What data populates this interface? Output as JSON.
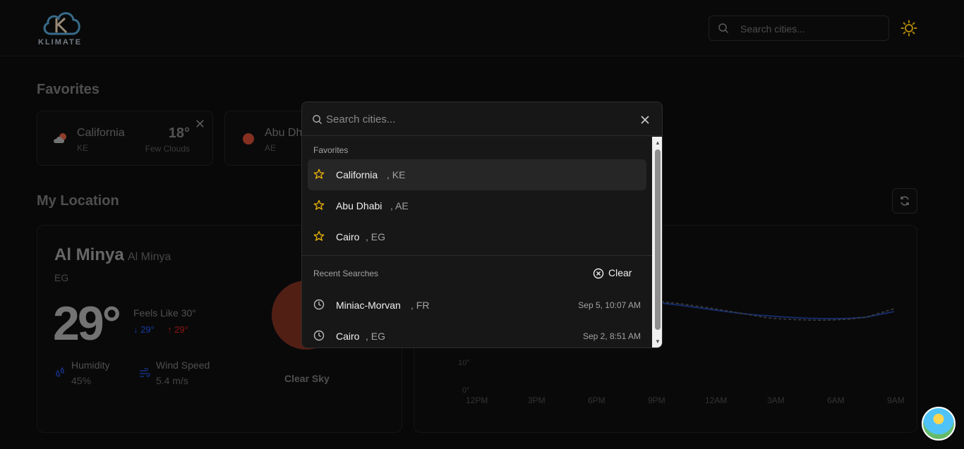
{
  "app": {
    "logo_text": "KLIMATE",
    "search_placeholder": "Search cities..."
  },
  "favorites_section": {
    "title": "Favorites",
    "cards": [
      {
        "city": "California",
        "country": "KE",
        "temp": "18°",
        "condition": "Few Clouds"
      },
      {
        "city": "Abu Dh",
        "country": "AE"
      }
    ]
  },
  "my_location": {
    "title": "My Location",
    "city": "Al Minya",
    "region": ", Al Minya",
    "country": "EG",
    "temp": "29°",
    "feels_like": "Feels Like 30°",
    "temp_min": "29°",
    "temp_max": "29°",
    "humidity_label": "Humidity",
    "humidity_value": "45%",
    "wind_label": "Wind Speed",
    "wind_value": "5.4 m/s",
    "condition": "Clear Sky"
  },
  "chart_data": {
    "type": "line",
    "x": [
      "12PM",
      "3PM",
      "6PM",
      "9PM",
      "12AM",
      "3AM",
      "6AM",
      "9AM"
    ],
    "y_ticks": [
      "10°",
      "0°"
    ]
  },
  "dialog": {
    "placeholder": "Search cities...",
    "favorites_heading": "Favorites",
    "favorites": [
      {
        "name": "California",
        "country": ", KE"
      },
      {
        "name": "Abu Dhabi",
        "country": ", AE"
      },
      {
        "name": "Cairo",
        "country": ", EG"
      }
    ],
    "recent_heading": "Recent Searches",
    "clear_label": "Clear",
    "recent": [
      {
        "name": "Miniac-Morvan",
        "country": ", FR",
        "time": "Sep 5, 10:07 AM"
      },
      {
        "name": "Cairo",
        "country": ", EG",
        "time": "Sep 2, 8:51 AM"
      }
    ]
  },
  "colors": {
    "accent_star": "#eab308",
    "temp_min_color": "#3b82f6",
    "temp_max_color": "#ef4444",
    "sun_icon": "#eab308"
  }
}
